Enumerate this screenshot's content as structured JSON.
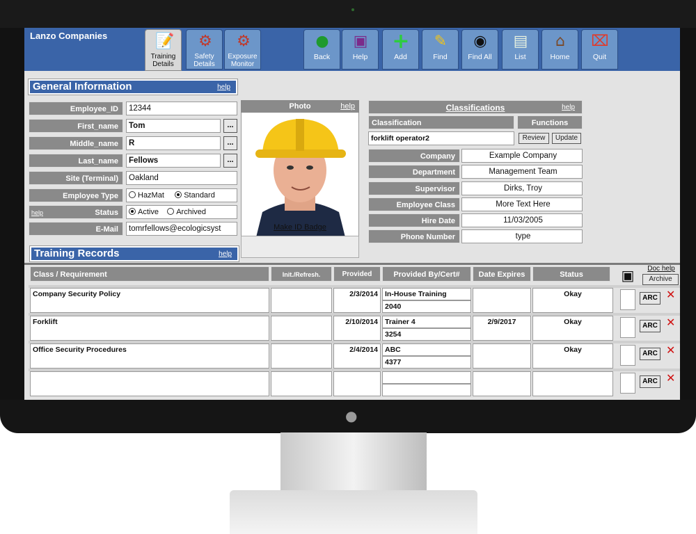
{
  "app": {
    "company": "Lanzo Companies"
  },
  "tabs": [
    {
      "label1": "Training",
      "label2": "Details",
      "icon": "training-icon",
      "active": true
    },
    {
      "label1": "Safety",
      "label2": "Details",
      "icon": "safety-icon",
      "active": false
    },
    {
      "label1": "Exposure",
      "label2": "Monitor",
      "icon": "exposure-icon",
      "active": false
    }
  ],
  "toolbar": [
    {
      "label": "Back",
      "icon": "back-icon"
    },
    {
      "label": "Help",
      "icon": "help-book-icon"
    },
    {
      "label": "Add",
      "icon": "add-icon"
    },
    {
      "label": "Find",
      "icon": "find-icon"
    },
    {
      "label": "Find All",
      "icon": "binoculars-icon"
    },
    {
      "label": "List",
      "icon": "list-icon"
    },
    {
      "label": "Home",
      "icon": "home-icon"
    },
    {
      "label": "Quit",
      "icon": "quit-icon"
    }
  ],
  "general": {
    "title": "General Information",
    "help": "help",
    "labels": {
      "employee_id": "Employee_ID",
      "first_name": "First_name",
      "middle_name": "Middle_name",
      "last_name": "Last_name",
      "site": "Site (Terminal)",
      "employee_type": "Employee Type",
      "status": "Status",
      "status_help": "help",
      "email": "E-Mail"
    },
    "values": {
      "employee_id": "12344",
      "first_name": "Tom",
      "middle_name": "R",
      "last_name": "Fellows",
      "site": "Oakland",
      "email": "tomrfellows@ecologicsyst"
    },
    "dots": "...",
    "employee_type_options": [
      "HazMat",
      "Standard"
    ],
    "employee_type_selected": "Standard",
    "status_options": [
      "Active",
      "Archived"
    ],
    "status_selected": "Active"
  },
  "photo": {
    "title": "Photo",
    "help": "help",
    "badge_link": "Make ID Badge"
  },
  "classifications": {
    "title": "Classifications",
    "help": "help",
    "col_classification": "Classification",
    "col_functions": "Functions",
    "value": "forklift operator2",
    "review_btn": "Review",
    "update_btn": "Update",
    "labels": {
      "company": "Company",
      "department": "Department",
      "supervisor": "Supervisor",
      "employee_class": "Employee Class",
      "hire_date": "Hire Date",
      "phone": "Phone Number"
    },
    "values": {
      "company": "Example Company",
      "department": "Management Team",
      "supervisor": "Dirks, Troy",
      "employee_class": "More Text Here",
      "hire_date": "11/03/2005",
      "phone": "type"
    }
  },
  "training": {
    "title": "Training Records",
    "help": "help",
    "headers": {
      "class": "Class / Requirement",
      "init": "Init./Refresh.",
      "provided": "Provided",
      "provided_by": "Provided By/Cert#",
      "expires": "Date Expires",
      "status": "Status",
      "doc_help": "Doc help",
      "archive": "Archive"
    },
    "arc_label": "ARC",
    "rows": [
      {
        "class": "Company Security Policy",
        "provided": "2/3/2014",
        "provider": "In-House Training",
        "cert": "2040",
        "expires": "",
        "status": "Okay"
      },
      {
        "class": "Forklift",
        "provided": "2/10/2014",
        "provider": "Trainer 4",
        "cert": "3254",
        "expires": "2/9/2017",
        "status": "Okay"
      },
      {
        "class": "Office Security Procedures",
        "provided": "2/4/2014",
        "provider": "ABC",
        "cert": "4377",
        "expires": "",
        "status": "Okay"
      },
      {
        "class": "",
        "provided": "",
        "provider": "",
        "cert": "",
        "expires": "",
        "status": ""
      }
    ]
  },
  "colors": {
    "header_blue": "#3a64a8",
    "label_gray": "#8a8a8a",
    "tab_blue": "#6c96c9"
  }
}
